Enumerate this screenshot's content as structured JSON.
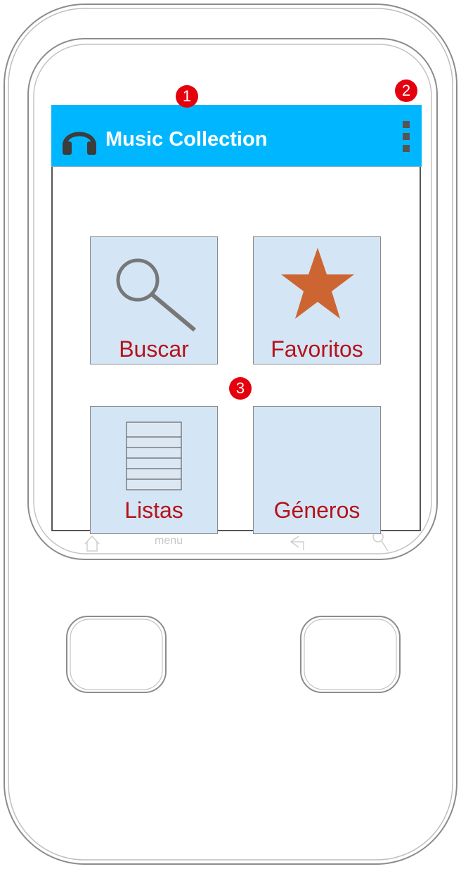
{
  "app": {
    "title": "Music Collection",
    "bar_color": "#00b7ff",
    "icon": "headphones-icon"
  },
  "overflow_menu": {
    "icon": "more-vert-icon"
  },
  "tiles": [
    {
      "label": "Buscar",
      "icon": "search-icon"
    },
    {
      "label": "Favoritos",
      "icon": "star-icon",
      "icon_color": "#cd6533"
    },
    {
      "label": "Listas",
      "icon": "list-icon"
    },
    {
      "label": "Géneros",
      "icon": ""
    }
  ],
  "markers": [
    "1",
    "2",
    "3"
  ],
  "hardware_keys": [
    "home",
    "menu",
    "back",
    "search"
  ],
  "hardware_menu_label": "menu"
}
